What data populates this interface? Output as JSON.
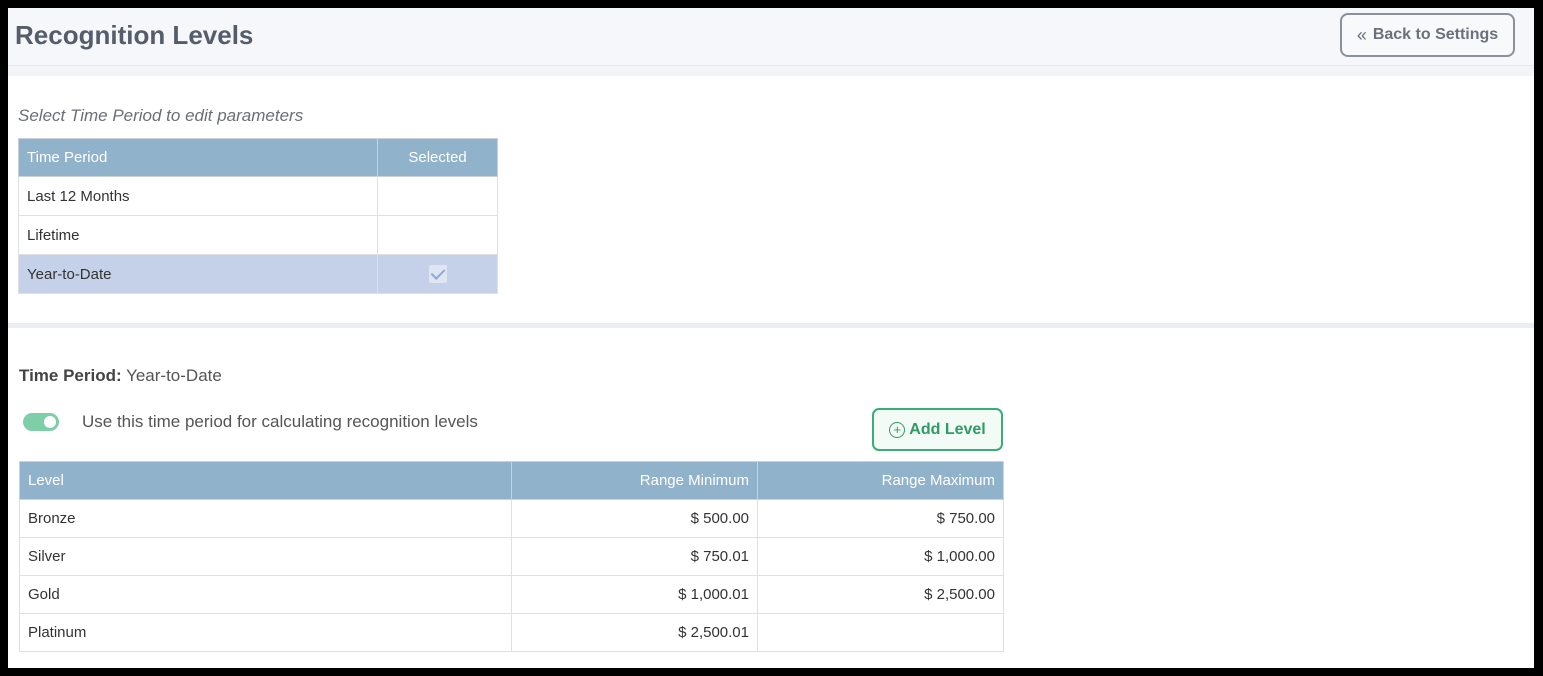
{
  "header": {
    "title": "Recognition Levels",
    "back_button": "Back to Settings",
    "back_icon": "chevrons-left-icon"
  },
  "period_selector": {
    "hint": "Select Time Period to edit parameters",
    "columns": [
      "Time Period",
      "Selected"
    ],
    "rows": [
      {
        "period": "Last 12 Months",
        "selected": false
      },
      {
        "period": "Lifetime",
        "selected": false
      },
      {
        "period": "Year-to-Date",
        "selected": true
      }
    ]
  },
  "detail": {
    "label": "Time Period:",
    "value": "Year-to-Date",
    "toggle_label": "Use this time period for calculating recognition levels",
    "toggle_on": true,
    "add_button": "Add Level",
    "columns": [
      "Level",
      "Range Minimum",
      "Range Maximum"
    ],
    "rows": [
      {
        "level": "Bronze",
        "min": "$ 500.00",
        "max": "$ 750.00"
      },
      {
        "level": "Silver",
        "min": "$ 750.01",
        "max": "$ 1,000.00"
      },
      {
        "level": "Gold",
        "min": "$ 1,000.01",
        "max": "$ 2,500.00"
      },
      {
        "level": "Platinum",
        "min": "$ 2,500.01",
        "max": ""
      }
    ]
  },
  "colors": {
    "header_bg": "#91b2cb",
    "selected_row": "#c5d1e8",
    "accent_green": "#3cab79"
  }
}
